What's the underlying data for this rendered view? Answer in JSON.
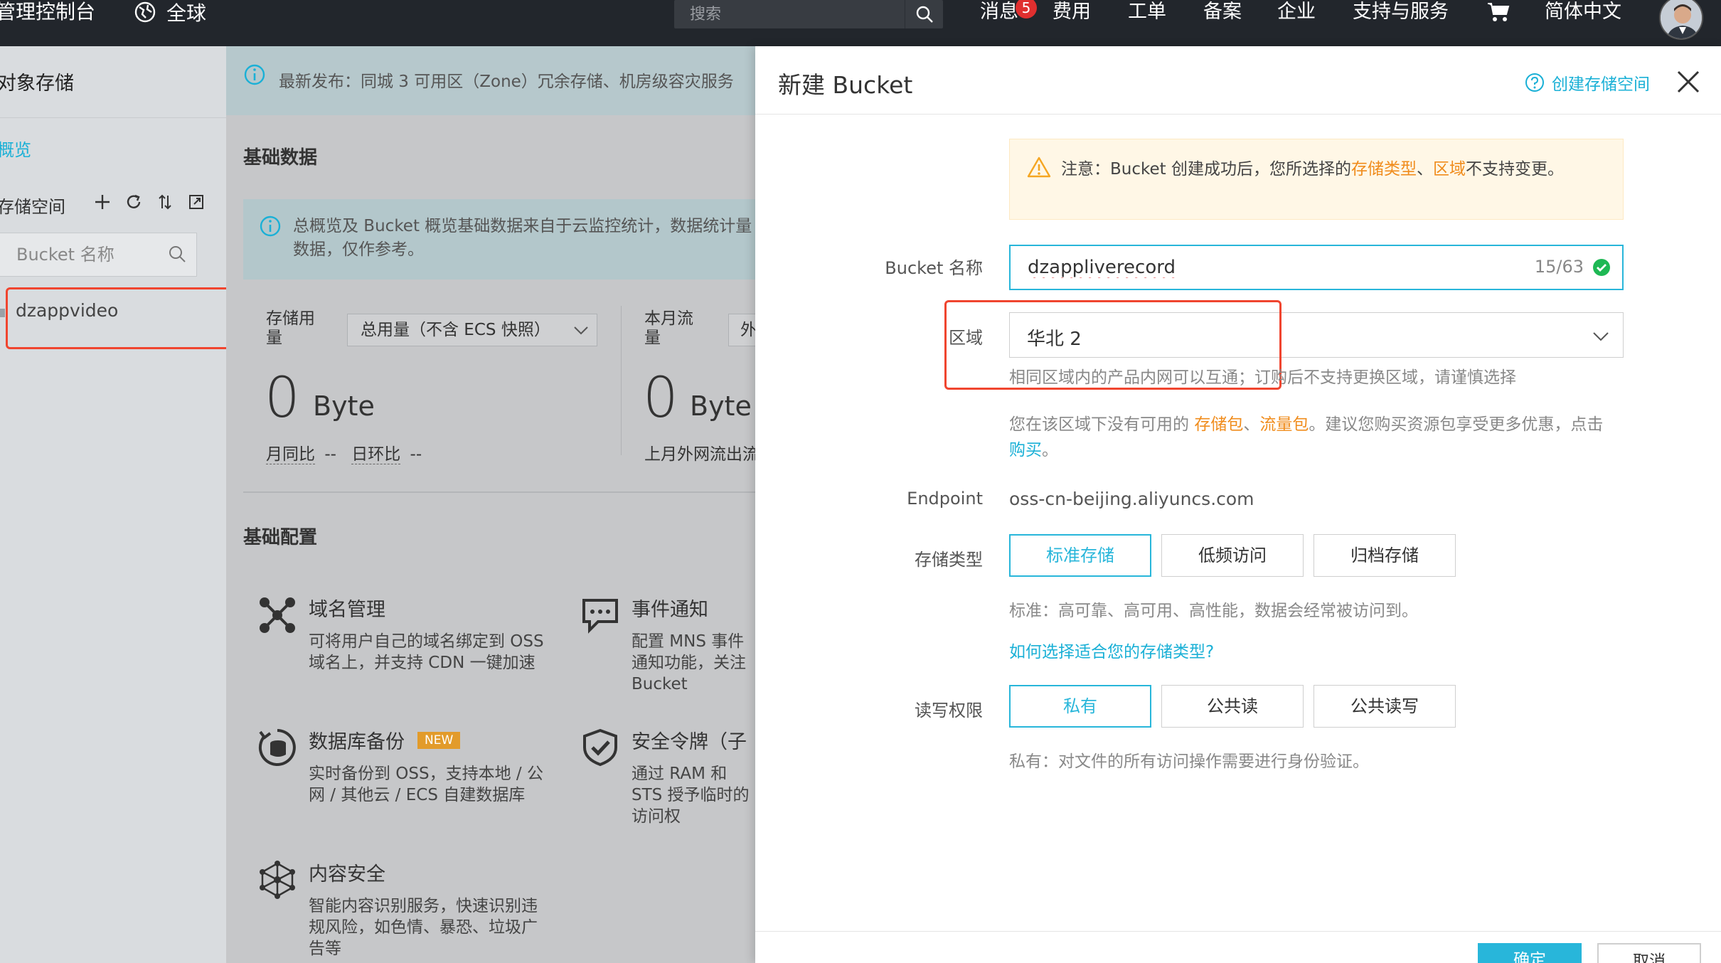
{
  "topbar": {
    "brand": "管理控制台",
    "region": "全球",
    "search_placeholder": "搜索",
    "nav": [
      "消息",
      "费用",
      "工单",
      "备案",
      "企业",
      "支持与服务",
      "简体中文"
    ],
    "message_badge": "5"
  },
  "sidebar": {
    "title": "对象存储",
    "overview": "概览",
    "buckets_label": "存储空间",
    "bucket_search_placeholder": "Bucket 名称",
    "buckets": [
      "dzappvideo"
    ]
  },
  "main": {
    "notice": "最新发布：同城 3 可用区（Zone）冗余存储、机房级容灾服务",
    "basic_data_title": "基础数据",
    "info": "总概览及 Bucket 概览基础数据来自于云监控统计，数据统计量数据，仅作参考。",
    "storage_usage_label": "存储用量",
    "storage_select": "总用量（不含 ECS 快照）",
    "monthly_traffic_label": "本月流量",
    "traffic_select": "外",
    "storage_value": "0",
    "storage_unit": "Byte",
    "traffic_value": "0",
    "traffic_unit": "Byte",
    "mom": "月同比",
    "mom_value": "--",
    "dod": "日环比",
    "dod_value": "--",
    "last_month": "上月外网流出流",
    "basic_config_title": "基础配置",
    "features": [
      {
        "title": "域名管理",
        "desc": "可将用户自己的域名绑定到 OSS 域名上，并支持 CDN 一键加速"
      },
      {
        "title": "事件通知",
        "desc": "配置 MNS 事件通知功能，关注 Bucket"
      },
      {
        "title": "数据库备份",
        "badge": "NEW",
        "desc": "实时备份到 OSS，支持本地 / 公网 / 其他云 / ECS 自建数据库"
      },
      {
        "title": "安全令牌（子",
        "desc": "通过 RAM 和 STS 授予临时的访问权"
      },
      {
        "title": "内容安全",
        "desc": "智能内容识别服务，快速识别违规风险，如色情、暴恐、垃圾广告等"
      }
    ]
  },
  "drawer": {
    "title": "新建 Bucket",
    "help": "创建存储空间",
    "warning": {
      "prefix": "注意：Bucket 创建成功后，您所选择的",
      "hl1": "存储类型",
      "sep": "、",
      "hl2": "区域",
      "suffix": "不支持变更。"
    },
    "name_label": "Bucket 名称",
    "name_value": "dzappliverecord",
    "name_counter": "15/63",
    "region_label": "区域",
    "region_value": "华北 2",
    "region_hint": "相同区域内的产品内网可以互通；订购后不支持更换区域，请谨慎选择",
    "package_hint": {
      "prefix": "您在该区域下没有可用的 ",
      "storage": "存储包",
      "sep": "、",
      "traffic": "流量包",
      "mid": "。建议您购买资源包享受更多优惠，点击 ",
      "buy": "购买",
      "end": "。"
    },
    "endpoint_label": "Endpoint",
    "endpoint_value": "oss-cn-beijing.aliyuncs.com",
    "storage_class_label": "存储类型",
    "storage_classes": [
      "标准存储",
      "低频访问",
      "归档存储"
    ],
    "storage_class_hint": "标准：高可靠、高可用、高性能，数据会经常被访问到。",
    "storage_class_link": "如何选择适合您的存储类型?",
    "acl_label": "读写权限",
    "acls": [
      "私有",
      "公共读",
      "公共读写"
    ],
    "acl_hint": "私有：对文件的所有访问操作需要进行身份验证。",
    "ok": "确定",
    "cancel": "取消"
  },
  "colors": {
    "accent": "#28b6da",
    "warning": "#f08c1c",
    "annotation": "#f0452f"
  }
}
